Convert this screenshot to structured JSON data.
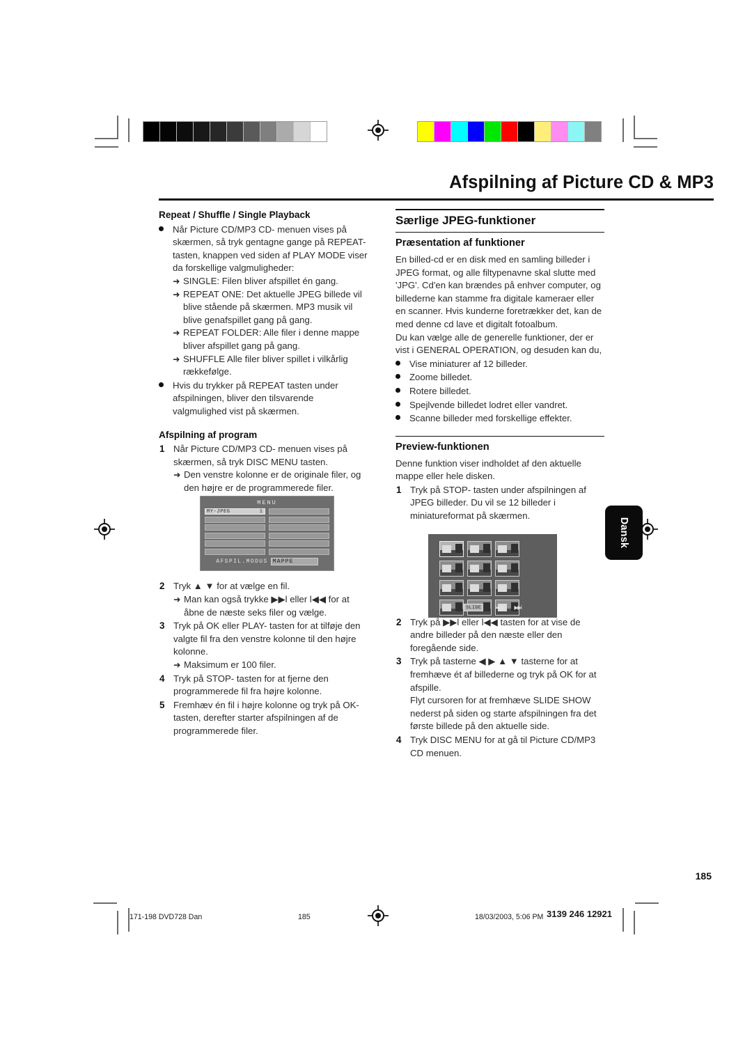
{
  "document": {
    "title": "Afspilning af Picture CD & MP3",
    "language_tab": "Dansk",
    "page_number": "185"
  },
  "print_marks": {
    "grayscale_steps": [
      "#000000",
      "#040404",
      "#0d0d0d",
      "#181818",
      "#262626",
      "#3b3b3b",
      "#5a5a5a",
      "#7f7f7f",
      "#ababab",
      "#d6d6d6",
      "#ffffff"
    ],
    "color_steps": [
      "#ffff00",
      "#ff00ff",
      "#00ffff",
      "#0000ff",
      "#00e800",
      "#ff0000",
      "#000000",
      "#ffef7a",
      "#ff8cf0",
      "#8cf5f5",
      "#808080"
    ]
  },
  "left_column": {
    "heading_repeat": "Repeat / Shuffle / Single Playback",
    "repeat_bullet_1": "Når Picture CD/MP3 CD- menuen vises på skærmen, så tryk gentagne gange på REPEAT- tasten, knappen ved siden af PLAY MODE viser da forskellige valgmuligheder:",
    "repeat_arrows": [
      "SINGLE: Filen bliver afspillet én gang.",
      "REPEAT ONE: Det aktuelle JPEG billede vil blive stående på skærmen. MP3 musik vil blive genafspillet gang på gang.",
      "REPEAT FOLDER: Alle filer i denne mappe bliver afspillet gang på gang.",
      "SHUFFLE Alle filer bliver spillet i vilkårlig rækkefølge."
    ],
    "repeat_bullet_2": "Hvis du trykker på REPEAT tasten under afspilningen, bliver den tilsvarende valgmulighed vist på skærmen.",
    "heading_program": "Afspilning af program",
    "program_steps": [
      {
        "num": "1",
        "text": "Når Picture CD/MP3 CD- menuen vises på skærmen, så tryk DISC MENU tasten.",
        "arrows": [
          "Den venstre kolonne er de originale filer, og den højre er de programmerede filer."
        ]
      },
      {
        "num": "2",
        "text": "Tryk ▲ ▼ for at vælge en fil.",
        "arrows": [
          "Man kan også trykke ▶▶l eller l◀◀ for at åbne de næste seks filer og vælge."
        ]
      },
      {
        "num": "3",
        "text": "Tryk på OK eller PLAY- tasten for at tilføje den valgte fil fra den venstre kolonne til den højre kolonne.",
        "arrows": [
          "Maksimum er 100 filer."
        ]
      },
      {
        "num": "4",
        "text": "Tryk på STOP- tasten for at fjerne den programmerede fil fra højre kolonne.",
        "arrows": []
      },
      {
        "num": "5",
        "text": "Fremhæv én fil i højre kolonne og tryk på OK- tasten, derefter starter afspilningen af de programmerede filer.",
        "arrows": []
      }
    ]
  },
  "menu_screenshot": {
    "title": "MENU",
    "selected_row_label": "MY-JPEG",
    "selected_row_index": "1",
    "left_rows": 6,
    "right_rows": 6,
    "footer_label": "AFSPIL.MODUS",
    "footer_value": "MAPPE"
  },
  "right_column": {
    "section_heading": "Særlige JPEG-funktioner",
    "heading_presentation": "Præsentation af funktioner",
    "presentation_paragraph_1": "En billed-cd er en disk med en samling billeder i JPEG format, og alle filtypenavne skal slutte med 'JPG'. Cd'en kan brændes på enhver computer, og billederne kan stamme fra digitale kameraer eller en scanner. Hvis kunderne foretrækker det, kan de med denne cd lave et digitalt fotoalbum.",
    "presentation_paragraph_2": "Du kan vælge alle de generelle funktioner, der er vist i GENERAL OPERATION, og desuden kan du,",
    "feature_bullets": [
      "Vise miniaturer af 12 billeder.",
      "Zoome billedet.",
      "Rotere billedet.",
      "Spejlvende billedet lodret eller vandret.",
      "Scanne billeder med forskellige effekter."
    ],
    "heading_preview": "Preview-funktionen",
    "preview_intro": "Denne funktion viser indholdet af den aktuelle mappe eller hele disken.",
    "preview_step_1": {
      "num": "1",
      "text": "Tryk på STOP- tasten under afspilningen af JPEG billeder. Du vil se 12 billeder i miniatureformat på skærmen."
    },
    "preview_steps_after": [
      {
        "num": "2",
        "text": "Tryk på ▶▶l eller l◀◀ tasten for at vise de andre billeder på den næste eller den foregående side.",
        "extra": ""
      },
      {
        "num": "3",
        "text": "Tryk på tasterne ◀ ▶ ▲ ▼ tasterne for at fremhæve ét af billederne og tryk på OK for at afspille.",
        "extra": "Flyt cursoren for at fremhæve SLIDE SHOW nederst på siden og starte afspilningen fra det første billede på den aktuelle side."
      },
      {
        "num": "4",
        "text": "Tryk DISC MENU for at gå til Picture CD/MP3 CD menuen.",
        "extra": ""
      }
    ]
  },
  "preview_screenshot": {
    "thumbnail_count": 12,
    "selected_thumbnail_index": "1",
    "nav_buttons": [
      "SLIDE",
      "l◀◀",
      "▶▶l"
    ]
  },
  "footer": {
    "file_label": "171-198 DVD728 Dan",
    "page_label": "185",
    "timestamp": "18/03/2003, 5:06 PM",
    "doc_code": "3139 246 12921"
  }
}
